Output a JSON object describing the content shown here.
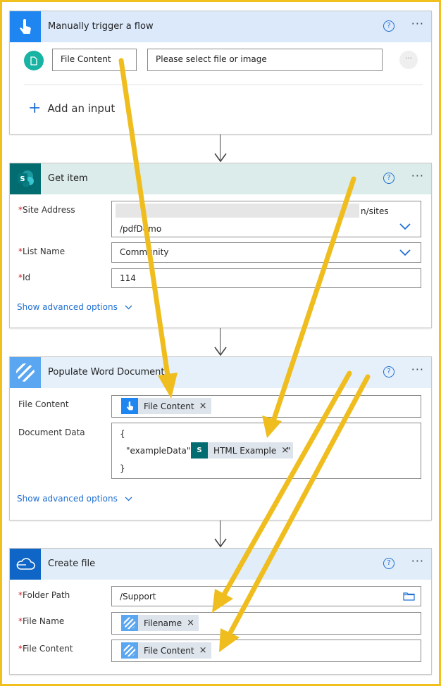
{
  "trigger": {
    "title": "Manually trigger a flow",
    "help": "?",
    "more": "···",
    "input_name": "File Content",
    "input_placeholder": "Please select file or image",
    "row_more": "···",
    "add_input": "Add an input",
    "add_icon": "+"
  },
  "get_item": {
    "title": "Get item",
    "help": "?",
    "more": "···",
    "site_label": "Site Address",
    "site_line1_suffix": "n/sites",
    "site_line2": "/pdfDemo",
    "list_label": "List Name",
    "list_value": "Community",
    "id_label": "Id",
    "id_value": "114",
    "advanced": "Show advanced options"
  },
  "populate": {
    "title": "Populate Word Document",
    "help": "?",
    "more": "···",
    "file_content_label": "File Content",
    "file_content_token": "File Content",
    "document_data_label": "Document Data",
    "json_open": "{",
    "json_key": "\"exampleData\": \"",
    "json_token": "HTML Example",
    "json_tail": "\"",
    "json_close": "}",
    "advanced": "Show advanced options"
  },
  "create_file": {
    "title": "Create file",
    "help": "?",
    "more": "···",
    "folder_label": "Folder Path",
    "folder_value": "/Support",
    "name_label": "File Name",
    "name_token": "Filename",
    "content_label": "File Content",
    "content_token": "File Content"
  },
  "required_mark": "*",
  "token_remove": "×",
  "colors": {
    "frame": "#f2c01c",
    "arrow": "#f0bd1f",
    "trigger_header": "#dbe9fb",
    "trigger_icon_bg": "#1f85f0",
    "sharepoint_header": "#dcecea",
    "sharepoint_icon_bg": "#036c70",
    "populate_header": "#e6f0fb",
    "populate_icon_bg": "#5aa6f0",
    "onedrive_header": "#e1edf9",
    "onedrive_icon_bg": "#0f66c7",
    "link": "#1f6fd1",
    "required": "#c4262e",
    "trigger_avatar": "#18b3a3"
  }
}
